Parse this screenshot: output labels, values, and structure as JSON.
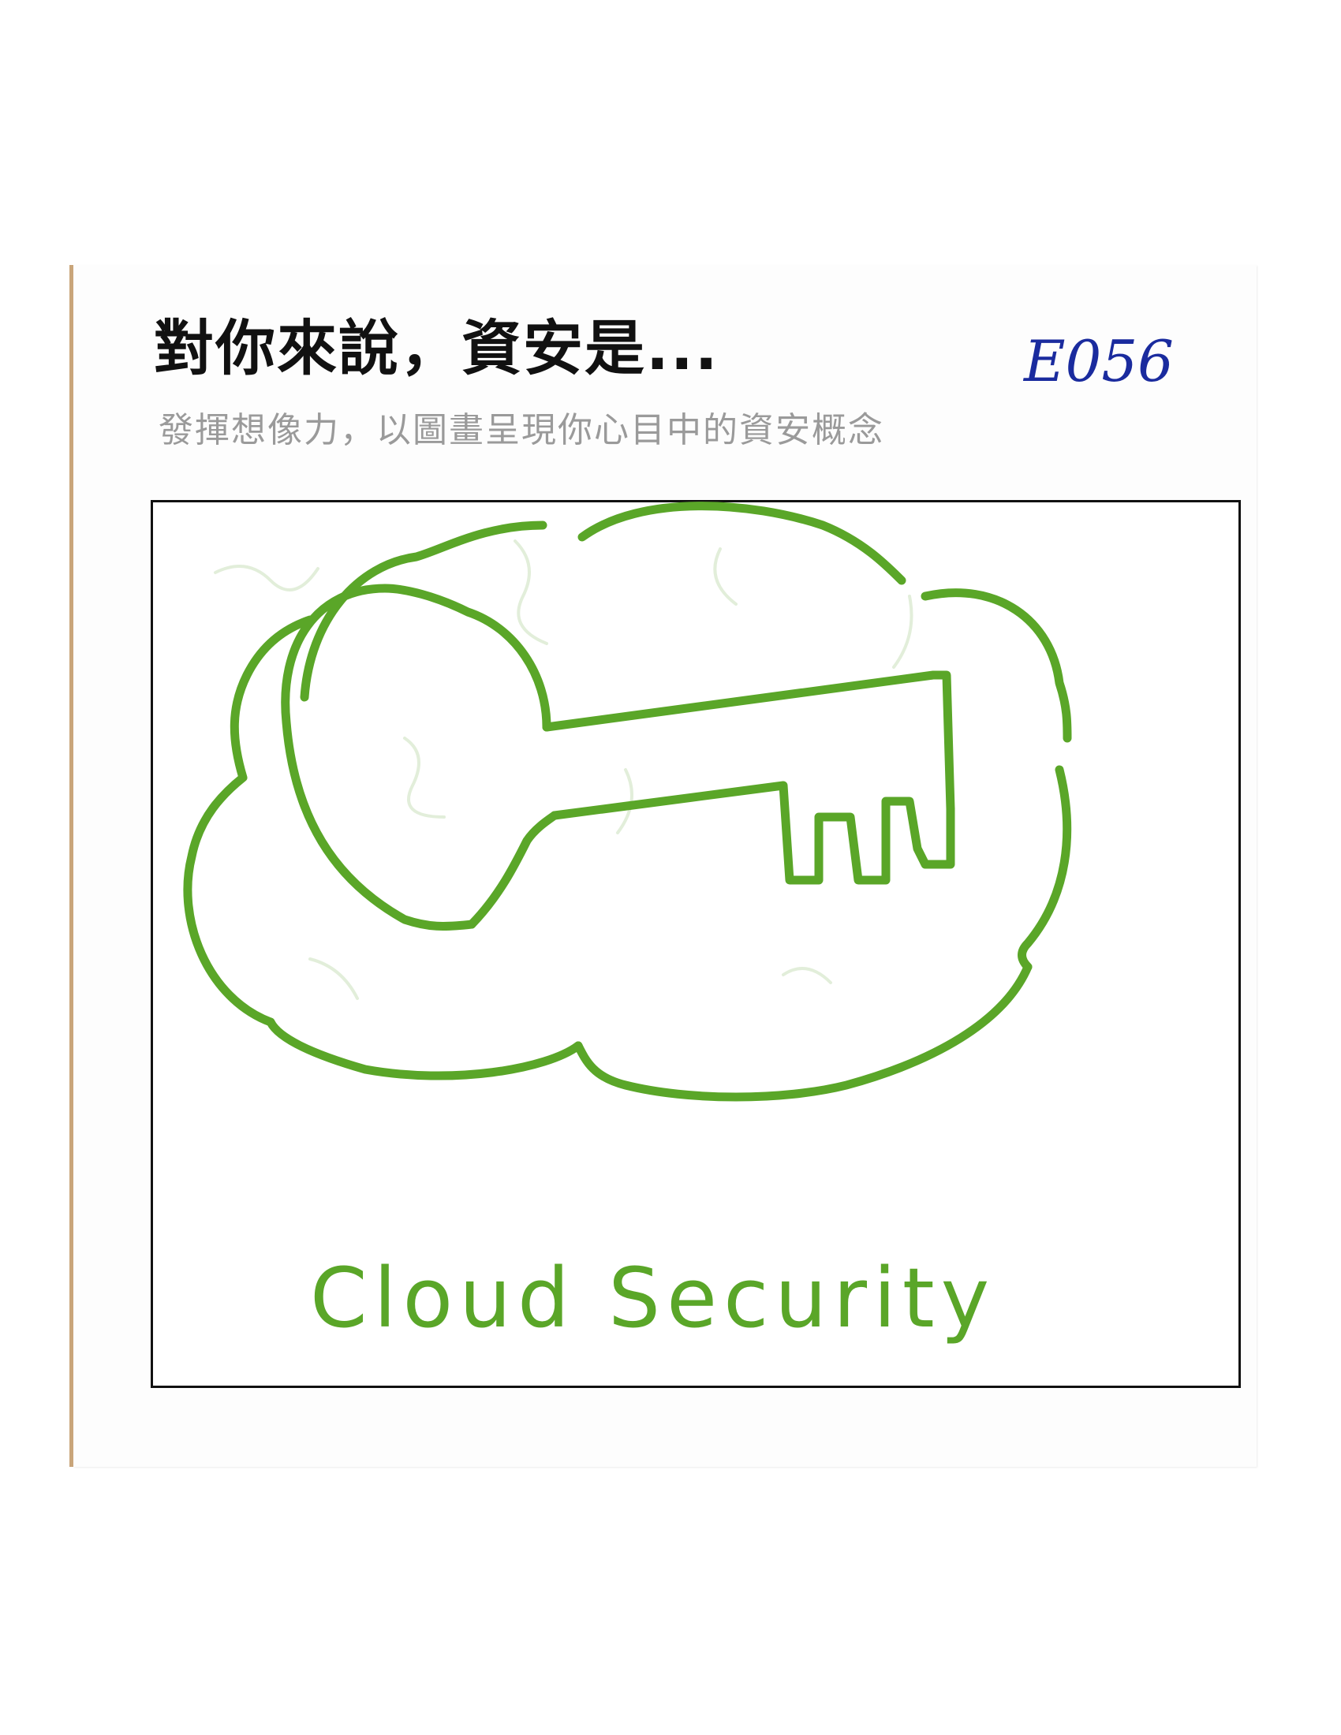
{
  "card": {
    "title": "對你來說，資安是...",
    "subtitle": "發揮想像力，以圖畫呈現你心目中的資安概念",
    "code": "E056"
  },
  "drawing": {
    "subject": "cloud with key",
    "caption": "Cloud Security",
    "ink_color": "#5aa628",
    "code_ink_color": "#1a2b9e"
  }
}
